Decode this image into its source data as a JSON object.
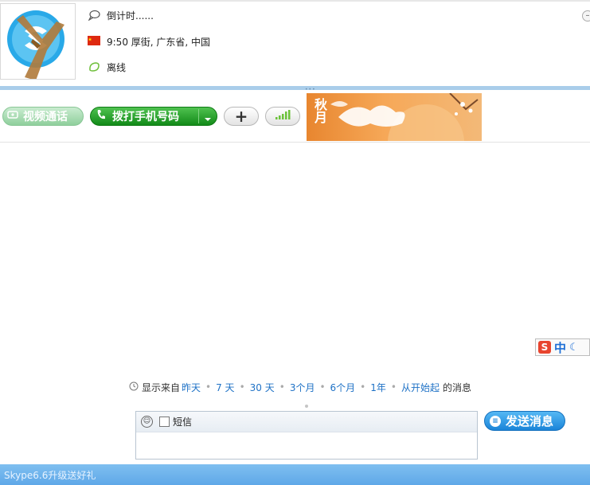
{
  "profile": {
    "countdown_text": "倒计时......",
    "location_text": "9:50 厚街, 广东省, 中国",
    "status_text": "离线"
  },
  "toolbar": {
    "video_call_label": "视频通话",
    "call_phone_label": "拨打手机号码",
    "add_label": "+"
  },
  "banner": {
    "text": "秋月"
  },
  "ime": {
    "logo": "S",
    "mode_label": "中",
    "moon": "☾"
  },
  "history": {
    "prefix": "显示来自",
    "links": [
      "昨天",
      "7 天",
      "30 天",
      "3个月",
      "6个月",
      "1年",
      "从开始起"
    ],
    "suffix": "的消息"
  },
  "compose": {
    "sms_label": "短信"
  },
  "send_button": {
    "label": "发送消息"
  },
  "footer": {
    "promo_text": "Skype6.6升级送好礼"
  },
  "colors": {
    "accent": "#1a84d8",
    "call_green": "#128a18",
    "footer_blue": "#6aaeea",
    "divider_blue": "#a9cdea"
  }
}
